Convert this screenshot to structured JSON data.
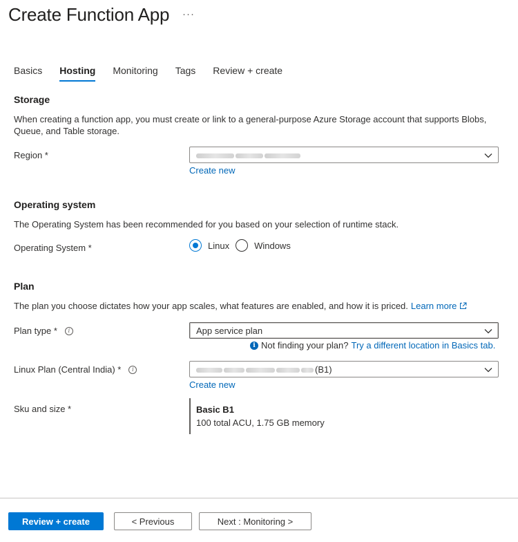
{
  "header": {
    "title": "Create Function App",
    "more": "···"
  },
  "tabs": [
    {
      "label": "Basics"
    },
    {
      "label": "Hosting",
      "active": true
    },
    {
      "label": "Monitoring"
    },
    {
      "label": "Tags"
    },
    {
      "label": "Review + create"
    }
  ],
  "storage": {
    "title": "Storage",
    "description": "When creating a function app, you must create or link to a general-purpose Azure Storage account that supports Blobs, Queue, and Table storage.",
    "region_label": "Region *",
    "create_new": "Create new"
  },
  "os": {
    "title": "Operating system",
    "description": "The Operating System has been recommended for you based on your selection of runtime stack.",
    "label": "Operating System *",
    "options": [
      "Linux",
      "Windows"
    ],
    "selected": "Linux"
  },
  "plan": {
    "title": "Plan",
    "description": "The plan you choose dictates how your app scales, what features are enabled, and how it is priced.",
    "learn_more": "Learn more",
    "plan_type_label": "Plan type *",
    "plan_type_value": "App service plan",
    "not_finding": "Not finding your plan?",
    "try_location": "Try a different location in Basics tab.",
    "linux_plan_label": "Linux Plan (Central India) *",
    "linux_plan_suffix": "(B1)",
    "create_new": "Create new",
    "sku_label": "Sku and size *",
    "sku_name": "Basic B1",
    "sku_detail": "100 total ACU, 1.75 GB memory"
  },
  "footer": {
    "review_create": "Review + create",
    "previous": "< Previous",
    "next": "Next : Monitoring >"
  },
  "colors": {
    "accent": "#0078d4",
    "link": "#0067b8",
    "text": "#323130"
  },
  "icons": {
    "chevron": "chevron-down-icon",
    "info": "info-icon",
    "external": "external-link-icon"
  }
}
